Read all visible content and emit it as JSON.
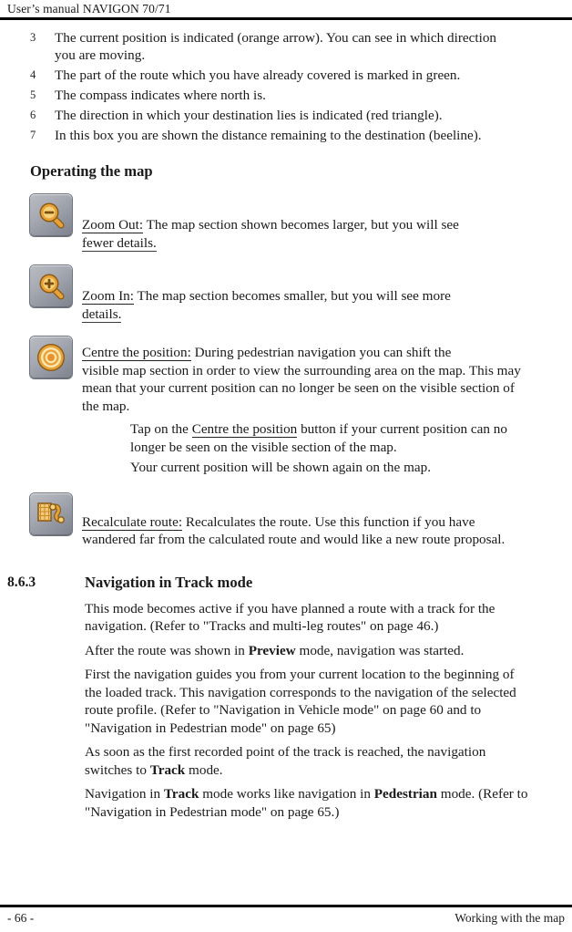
{
  "header": {
    "running_title": "User’s manual NAVIGON 70/71"
  },
  "legend": {
    "items": [
      {
        "num": "3",
        "text": "The current position is indicated (orange arrow). You can see in which direction you are moving."
      },
      {
        "num": "4",
        "text": "The part of the route which you have already covered is marked in green."
      },
      {
        "num": "5",
        "text": "The compass indicates where north is."
      },
      {
        "num": "6",
        "text": "The direction in which your destination lies is indicated (red triangle)."
      },
      {
        "num": "7",
        "text": "In this box you are shown the distance remaining to the destination (beeline)."
      }
    ]
  },
  "operating_map": {
    "heading": "Operating the map",
    "entries": [
      {
        "icon": "zoom-out-icon",
        "label": "Zoom Out:",
        "text_line1": " The map section shown becomes larger, but you will see",
        "text_line2": "fewer details."
      },
      {
        "icon": "zoom-in-icon",
        "label": "Zoom In:",
        "text_line1": " The map section becomes smaller, but you will see more",
        "text_line2": "details."
      },
      {
        "icon": "centre-position-icon",
        "label": "Centre the position:",
        "text_line1": " During pedestrian navigation you can shift the",
        "text_line2": "visible map section in order to view the surrounding area on the map. This may mean that your current position can no longer be seen on the visible section of the map."
      },
      {
        "icon": "recalculate-route-icon",
        "label": "Recalculate route:",
        "text_line1": " Recalculates the route. Use this function if you have",
        "text_line2": "wandered far from the calculated route and would like a new route proposal."
      }
    ],
    "steps": [
      {
        "prefix": "Tap on the ",
        "emphasis": "Centre the position",
        "suffix": " button if your current position can no longer be seen on the visible section of the map."
      },
      {
        "prefix": "Your current position will be shown again on the map.",
        "emphasis": "",
        "suffix": ""
      }
    ]
  },
  "section": {
    "number": "8.6.3",
    "title": "Navigation in Track mode",
    "paragraphs": [
      {
        "parts": [
          {
            "t": "This mode becomes active if you have planned a route with a track for the navigation. (Refer to \"Tracks and multi-leg routes\" on page 46.)",
            "b": false
          }
        ]
      },
      {
        "parts": [
          {
            "t": "After the route was shown in ",
            "b": false
          },
          {
            "t": "Preview",
            "b": true
          },
          {
            "t": " mode, navigation was started.",
            "b": false
          }
        ]
      },
      {
        "parts": [
          {
            "t": "First the navigation guides you from your current location to the beginning of the loaded track. This navigation corresponds to the navigation of the selected route profile. (Refer to \"Navigation in Vehicle mode\" on page 60 and to \"Navigation in Pedestrian mode\" on page 65)",
            "b": false
          }
        ]
      },
      {
        "parts": [
          {
            "t": "As soon as the first recorded point of the track is reached, the navigation switches to ",
            "b": false
          },
          {
            "t": "Track",
            "b": true
          },
          {
            "t": " mode.",
            "b": false
          }
        ]
      },
      {
        "parts": [
          {
            "t": "Navigation in ",
            "b": false
          },
          {
            "t": "Track",
            "b": true
          },
          {
            "t": " mode works like navigation in ",
            "b": false
          },
          {
            "t": "Pedestrian",
            "b": true
          },
          {
            "t": " mode. (Refer to \"Navigation in Pedestrian mode\" on page 65.)",
            "b": false
          }
        ]
      }
    ]
  },
  "footer": {
    "page_number": "- 66 -",
    "chapter": "Working with the map"
  },
  "colors": {
    "icon_gold": "#e8a23a",
    "icon_gold_light": "#f6d27a",
    "icon_gold_dark": "#a66a14",
    "button_gray": "#a7aab3",
    "rule": "#000000"
  }
}
